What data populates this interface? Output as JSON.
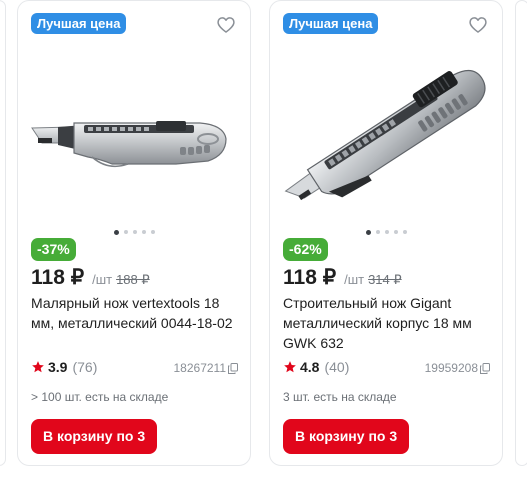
{
  "products": [
    {
      "badge": "Лучшая цена",
      "discount": "-37%",
      "price": "118 ₽",
      "unit": "/шт",
      "old_price": "188 ₽",
      "title": "Малярный нож vertextools 18 мм, металлический 0044-18-02",
      "rating": "3.9",
      "reviews": "(76)",
      "code": "18267211",
      "stock": "> 100 шт. есть на складе",
      "cart_button": "В корзину по 3"
    },
    {
      "badge": "Лучшая цена",
      "discount": "-62%",
      "price": "118 ₽",
      "unit": "/шт",
      "old_price": "314 ₽",
      "title": "Строительный нож Gigant металлический корпус 18 мм GWK 632",
      "rating": "4.8",
      "reviews": "(40)",
      "code": "19959208",
      "stock": "3 шт. есть на складе",
      "cart_button": "В корзину по 3"
    }
  ],
  "icons": {
    "favorite": "heart-icon",
    "rating": "star-icon",
    "copy": "copy-icon"
  },
  "colors": {
    "best_price_badge": "#2f8ee5",
    "discount_badge": "#46ac38",
    "cart_button": "#e1061b",
    "star": "#e1061b"
  }
}
